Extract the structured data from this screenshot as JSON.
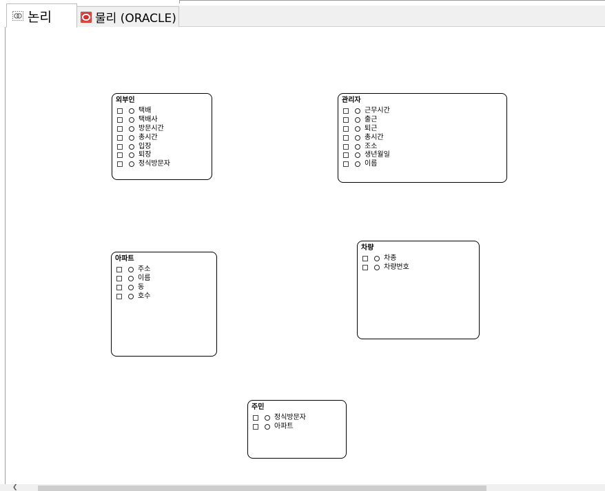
{
  "tabs": [
    {
      "label": "논리",
      "icon": "logical-model-icon",
      "selected": true
    },
    {
      "label": "물리 (ORACLE)",
      "icon": "oracle-db-icon",
      "selected": false
    }
  ],
  "colors": {
    "oracle_red": "#d0312d",
    "tab_bg": "#f0f0f0",
    "border": "#000000"
  },
  "entities": {
    "visitor": {
      "title": "외부인",
      "attributes": [
        "택배",
        "택배사",
        "방문시간",
        "총시간",
        "입장",
        "퇴장",
        "정식방문자"
      ]
    },
    "manager": {
      "title": "관리자",
      "attributes": [
        "근무시간",
        "출근",
        "퇴근",
        "총시간",
        "조소",
        "생년월일",
        "이름"
      ]
    },
    "apartment": {
      "title": "아파트",
      "attributes": [
        "주소",
        "이름",
        "동",
        "호수"
      ]
    },
    "vehicle": {
      "title": "차량",
      "attributes": [
        "차종",
        "차량번호"
      ]
    },
    "resident": {
      "title": "주민",
      "attributes": [
        "정식방문자",
        "아파트"
      ]
    }
  }
}
